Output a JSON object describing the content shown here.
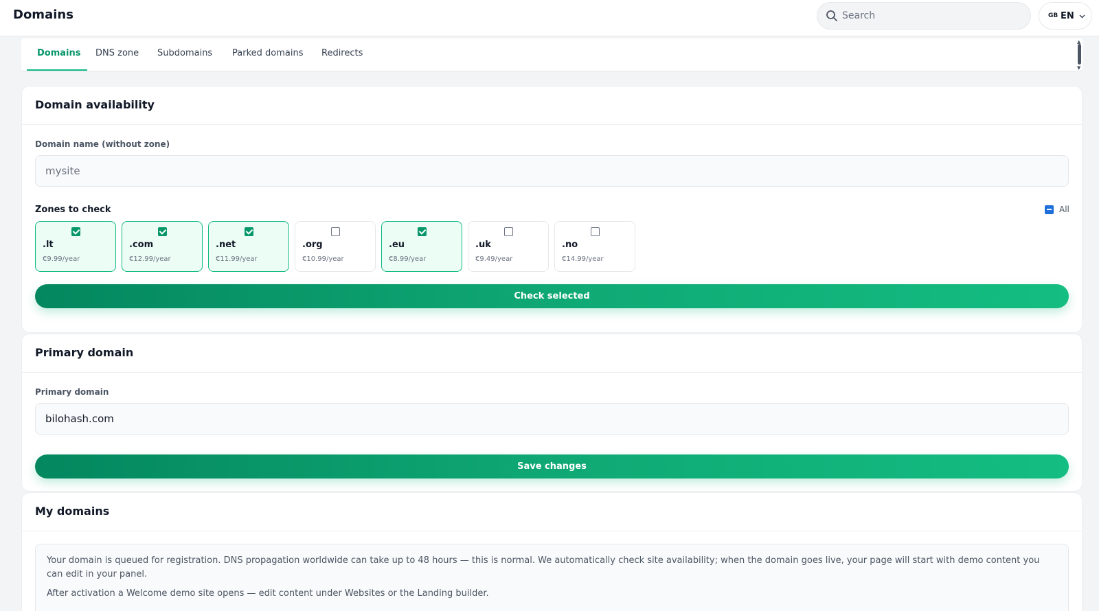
{
  "header": {
    "title": "Domains",
    "search_placeholder": "Search",
    "language": {
      "flag": "GB",
      "code": "EN"
    }
  },
  "tabs": [
    {
      "label": "Domains",
      "active": true
    },
    {
      "label": "DNS zone",
      "active": false
    },
    {
      "label": "Subdomains",
      "active": false
    },
    {
      "label": "Parked domains",
      "active": false
    },
    {
      "label": "Redirects",
      "active": false
    }
  ],
  "availability": {
    "title": "Domain availability",
    "domain_label": "Domain name (without zone)",
    "domain_placeholder": "mysite",
    "zones_label": "Zones to check",
    "all_label": "All",
    "zones": [
      {
        "name": ".lt",
        "price": "€9.99/year",
        "checked": true
      },
      {
        "name": ".com",
        "price": "€12.99/year",
        "checked": true
      },
      {
        "name": ".net",
        "price": "€11.99/year",
        "checked": true
      },
      {
        "name": ".org",
        "price": "€10.99/year",
        "checked": false
      },
      {
        "name": ".eu",
        "price": "€8.99/year",
        "checked": true
      },
      {
        "name": ".uk",
        "price": "€9.49/year",
        "checked": false
      },
      {
        "name": ".no",
        "price": "€14.99/year",
        "checked": false
      }
    ],
    "check_button": "Check selected"
  },
  "primary": {
    "title": "Primary domain",
    "field_label": "Primary domain",
    "value": "bilohash.com",
    "save_button": "Save changes"
  },
  "my_domains": {
    "title": "My domains",
    "notice_p1": "Your domain is queued for registration. DNS propagation worldwide can take up to 48 hours — this is normal. We automatically check site availability; when the domain goes live, your page will start with demo content you can edit in your panel.",
    "notice_p2": "After activation a Welcome demo site opens — edit content under Websites or the Landing builder."
  },
  "colors": {
    "accent": "#10b981",
    "accent_dark": "#059669",
    "checkbox_blue": "#1e6fd9"
  }
}
